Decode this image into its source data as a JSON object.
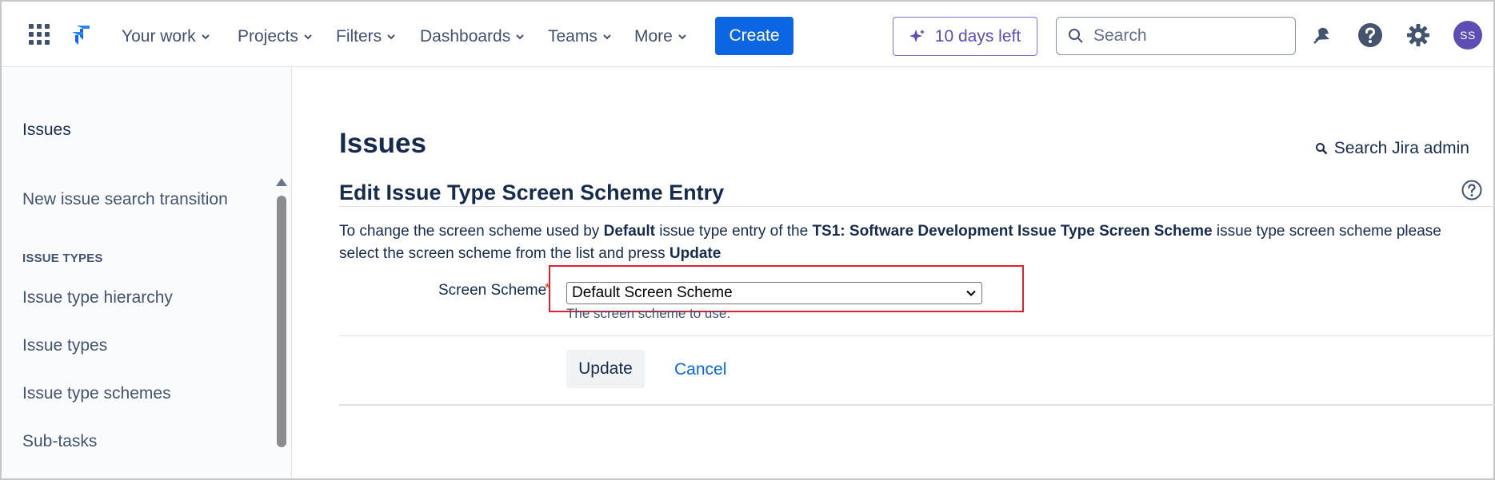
{
  "nav": {
    "menus": [
      {
        "label": "Your work"
      },
      {
        "label": "Projects"
      },
      {
        "label": "Filters"
      },
      {
        "label": "Dashboards"
      },
      {
        "label": "Teams"
      },
      {
        "label": "More"
      }
    ],
    "create_label": "Create",
    "trial_label": "10 days left",
    "search_placeholder": "Search",
    "avatar_initials": "SS",
    "icons": [
      "app-switcher-icon",
      "jira-logo",
      "notifications-icon",
      "help-icon",
      "settings-icon"
    ]
  },
  "sidebar": {
    "title": "Issues",
    "item_search_transition": "New issue search transition",
    "heading_issue_types": "ISSUE TYPES",
    "item_hierarchy": "Issue type hierarchy",
    "item_types": "Issue types",
    "item_schemes": "Issue type schemes",
    "item_subtasks": "Sub-tasks"
  },
  "main": {
    "page_title": "Issues",
    "admin_search_label": "Search Jira admin",
    "section_title": "Edit Issue Type Screen Scheme Entry",
    "desc_prefix": "To change the screen scheme used by ",
    "desc_bold_1": "Default",
    "desc_mid": " issue type entry of the ",
    "desc_bold_2": "TS1: Software Development Issue Type Screen Scheme",
    "desc_suffix": " issue type screen scheme please select the screen scheme from the list and press ",
    "desc_bold_3": "Update",
    "field_label": "Screen Scheme",
    "required_marker": "*",
    "select_value": "Default Screen Scheme",
    "field_hint": "The screen scheme to use.",
    "update_label": "Update",
    "cancel_label": "Cancel"
  },
  "colors": {
    "primary": "#0c66e4",
    "trial_accent": "#5e4db2",
    "highlight": "#e0202f",
    "text": "#172b4d"
  }
}
